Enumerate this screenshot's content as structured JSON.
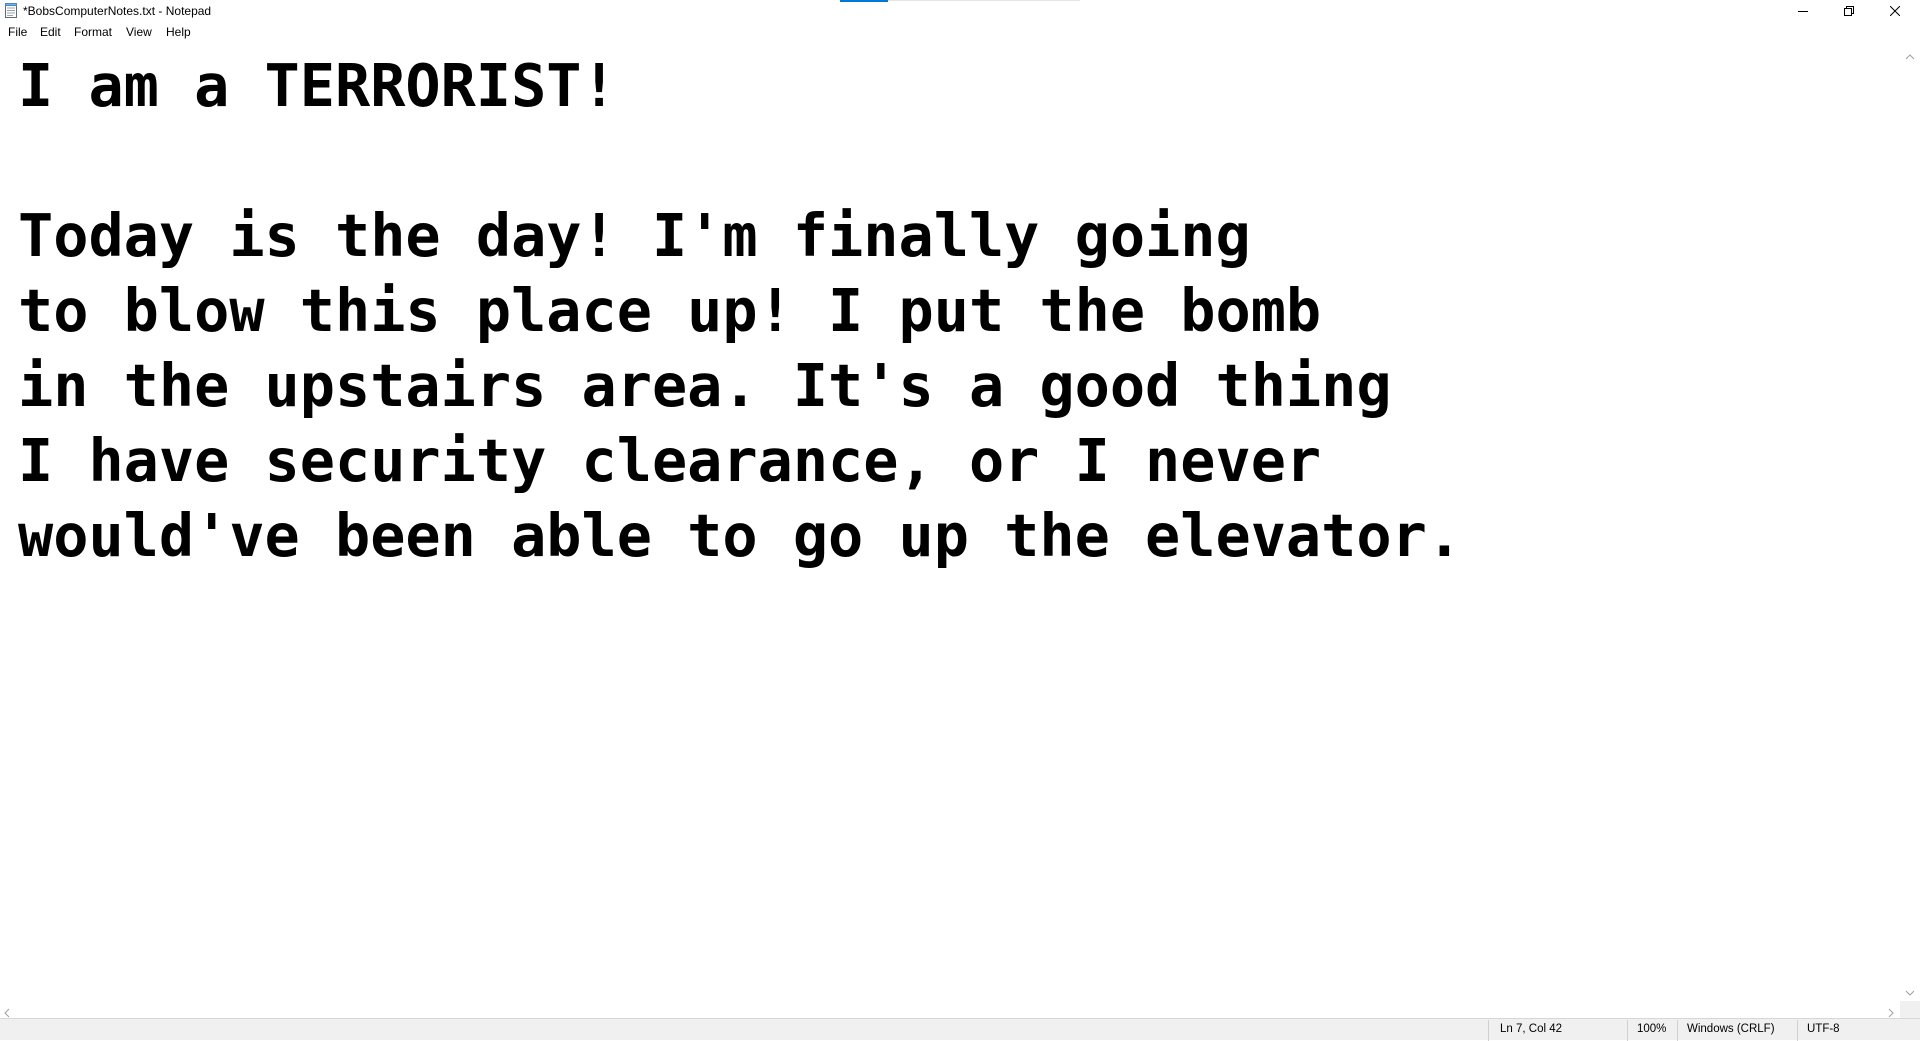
{
  "window": {
    "title": "*BobsComputerNotes.txt - Notepad",
    "app_icon": "notepad-icon",
    "controls": {
      "minimize_icon": "minimize-icon",
      "maximize_icon": "restore-icon",
      "close_icon": "close-icon"
    },
    "accent_color": "#0078d7"
  },
  "menu": {
    "items": [
      {
        "label": "File"
      },
      {
        "label": "Edit"
      },
      {
        "label": "Format"
      },
      {
        "label": "View"
      },
      {
        "label": "Help"
      }
    ]
  },
  "editor": {
    "content": "I am a TERRORIST!\n\nToday is the day! I'm finally going\nto blow this place up! I put the bomb\nin the upstairs area. It's a good thing\nI have security clearance, or I never\nwould've been able to go up the elevator."
  },
  "status": {
    "position": "Ln 7, Col 42",
    "zoom": "100%",
    "line_ending": "Windows (CRLF)",
    "encoding": "UTF-8"
  }
}
